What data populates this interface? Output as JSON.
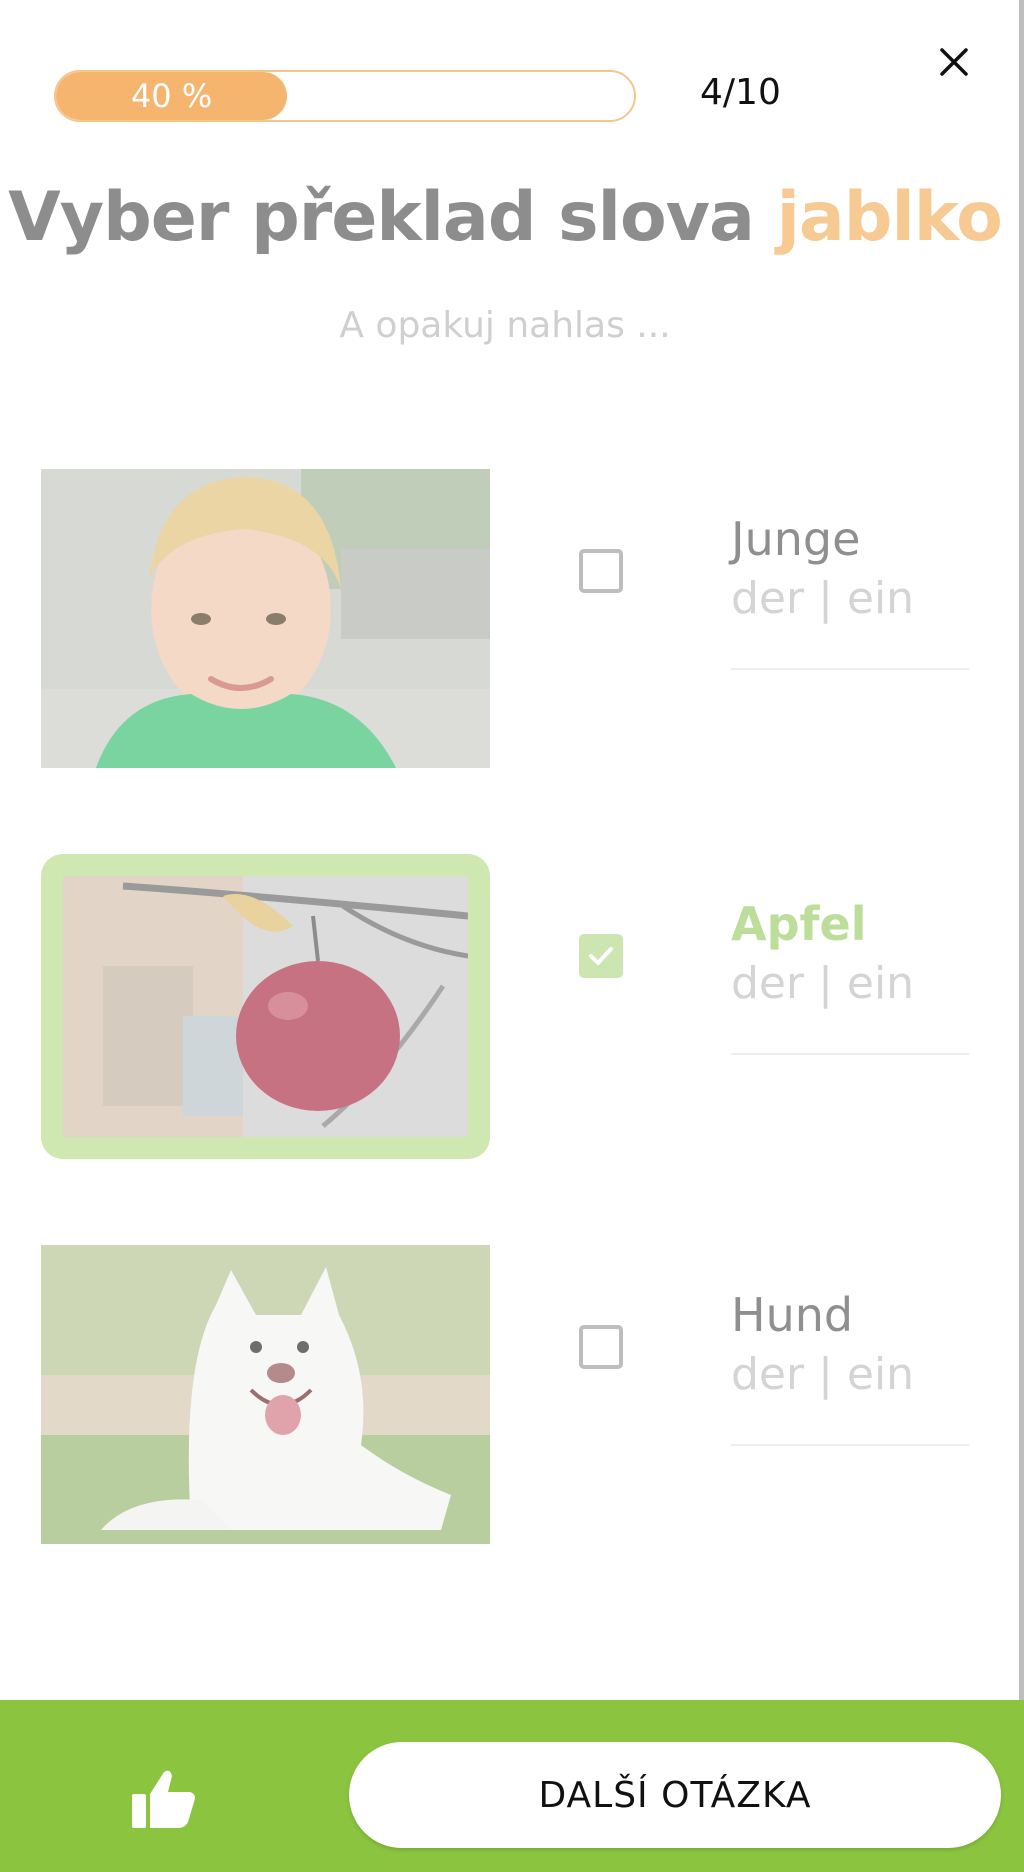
{
  "progress": {
    "percent": 40,
    "percent_label": "40 %",
    "counter": "4/10"
  },
  "prompt": {
    "title_prefix": "Vyber překlad slova",
    "target_word": "jablko",
    "subtitle": "A opakuj nahlas ..."
  },
  "options": [
    {
      "word": "Junge",
      "article": "der | ein",
      "checked": false,
      "image_icon": "boy-photo"
    },
    {
      "word": "Apfel",
      "article": "der | ein",
      "checked": true,
      "image_icon": "apple-photo"
    },
    {
      "word": "Hund",
      "article": "der | ein",
      "checked": false,
      "image_icon": "dog-photo"
    }
  ],
  "footer": {
    "next_label": "DALŠÍ OTÁZKA",
    "thumb_icon": "thumbs-up-icon"
  },
  "colors": {
    "accent_orange": "#f6b56e",
    "selected_green": "#cfe7b0",
    "bar_green": "#8bc53f"
  }
}
